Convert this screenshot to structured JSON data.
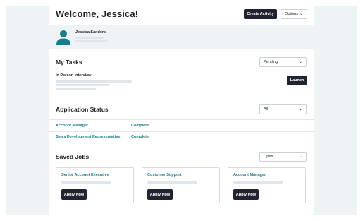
{
  "header": {
    "title": "Welcome, Jessica!",
    "create_activity_label": "Create Activity",
    "options_label": "Options"
  },
  "profile": {
    "name": "Jessica Sanders",
    "avatar_icon": "user-avatar-icon"
  },
  "tasks": {
    "title": "My Tasks",
    "filter_value": "Pending",
    "items": [
      {
        "title": "In Person Interview",
        "action_label": "Launch"
      }
    ]
  },
  "application_status": {
    "title": "Application Status",
    "filter_value": "All",
    "rows": [
      {
        "job": "Account Manager",
        "status": "Complete"
      },
      {
        "job": "Sales Development  Representative",
        "status": "Complete"
      }
    ]
  },
  "saved_jobs": {
    "title": "Saved Jobs",
    "filter_value": "Open",
    "cards": [
      {
        "title": "Senior Account Executive",
        "action_label": "Apply Now"
      },
      {
        "title": "Customer Support",
        "action_label": "Apply Now"
      },
      {
        "title": "Account Manager",
        "action_label": "Apply Now"
      }
    ]
  },
  "colors": {
    "accent": "#1c7d86",
    "dark_button": "#1f2430",
    "side_panel": "#eef3f5"
  }
}
